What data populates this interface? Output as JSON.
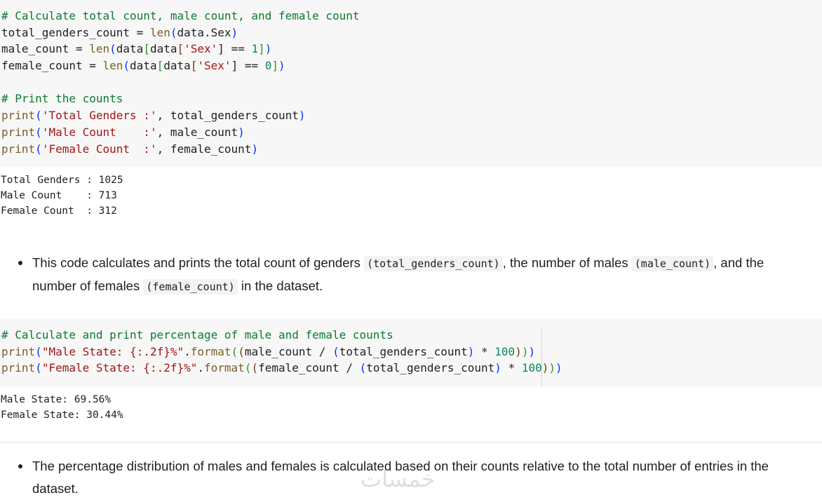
{
  "cell1": {
    "l1": "# Calculate total count, male count, and female count",
    "l2a": "total_genders_count",
    "l2b": " = ",
    "l2c": "len",
    "l2d": "(",
    "l2e": "data.Sex",
    "l2f": ")",
    "l3a": "male_count",
    "l3b": " = ",
    "l3c": "len",
    "l3d": "(",
    "l3e": "data",
    "l3f": "[",
    "l3g": "data",
    "l3h": "[",
    "l3i": "'Sex'",
    "l3j": "] == ",
    "l3k": "1",
    "l3l": "]",
    "l3m": ")",
    "l4a": "female_count",
    "l4b": " = ",
    "l4c": "len",
    "l4d": "(",
    "l4e": "data",
    "l4f": "[",
    "l4g": "data",
    "l4h": "[",
    "l4i": "'Sex'",
    "l4j": "] == ",
    "l4k": "0",
    "l4l": "]",
    "l4m": ")",
    "l6": "# Print the counts",
    "l7a": "print",
    "l7b": "(",
    "l7c": "'Total Genders :'",
    "l7d": ", total_genders_count",
    "l7e": ")",
    "l8a": "print",
    "l8b": "(",
    "l8c": "'Male Count    :'",
    "l8d": ", male_count",
    "l8e": ")",
    "l9a": "print",
    "l9b": "(",
    "l9c": "'Female Count  :'",
    "l9d": ", female_count",
    "l9e": ")"
  },
  "output1": {
    "line1": "Total Genders : 1025",
    "line2": "Male Count    : 713",
    "line3": "Female Count  : 312"
  },
  "bullet1": {
    "t1": "This code calculates and prints the total count of genders ",
    "c1": "(total_genders_count)",
    "t2": ", the number of males ",
    "c2": "(male_count)",
    "t3": ", and the number of females ",
    "c3": "(female_count)",
    "t4": " in the dataset."
  },
  "cell2": {
    "l1": "# Calculate and print percentage of male and female counts",
    "l2a": "print",
    "l2b": "(",
    "l2c": "\"Male State: {:.2f}%\"",
    "l2d": ".",
    "l2e": "format",
    "l2f": "(",
    "l2g": "(",
    "l2h": "male_count / ",
    "l2i": "(",
    "l2j": "total_genders_count",
    "l2k": ")",
    "l2l": " * ",
    "l2m": "100",
    "l2n": ")",
    "l2o": ")",
    "l2p": ")",
    "l3a": "print",
    "l3b": "(",
    "l3c": "\"Female State: {:.2f}%\"",
    "l3d": ".",
    "l3e": "format",
    "l3f": "(",
    "l3g": "(",
    "l3h": "female_count / ",
    "l3i": "(",
    "l3j": "total_genders_count",
    "l3k": ")",
    "l3l": " * ",
    "l3m": "100",
    "l3n": ")",
    "l3o": ")",
    "l3p": ")"
  },
  "output2": {
    "line1": "Male State: 69.56%",
    "line2": "Female State: 30.44%"
  },
  "bullet2": {
    "text": "The percentage distribution of males and females is calculated based on their counts relative to the total number of entries in the dataset."
  },
  "watermark": {
    "text": "خمسات"
  },
  "colors": {
    "code_background": "#f7f7f7",
    "comment": "#0b7a2f",
    "function": "#795e26",
    "string": "#a31515",
    "number": "#098658",
    "bracket_level1": "#0431fa",
    "bracket_level2": "#319331"
  }
}
